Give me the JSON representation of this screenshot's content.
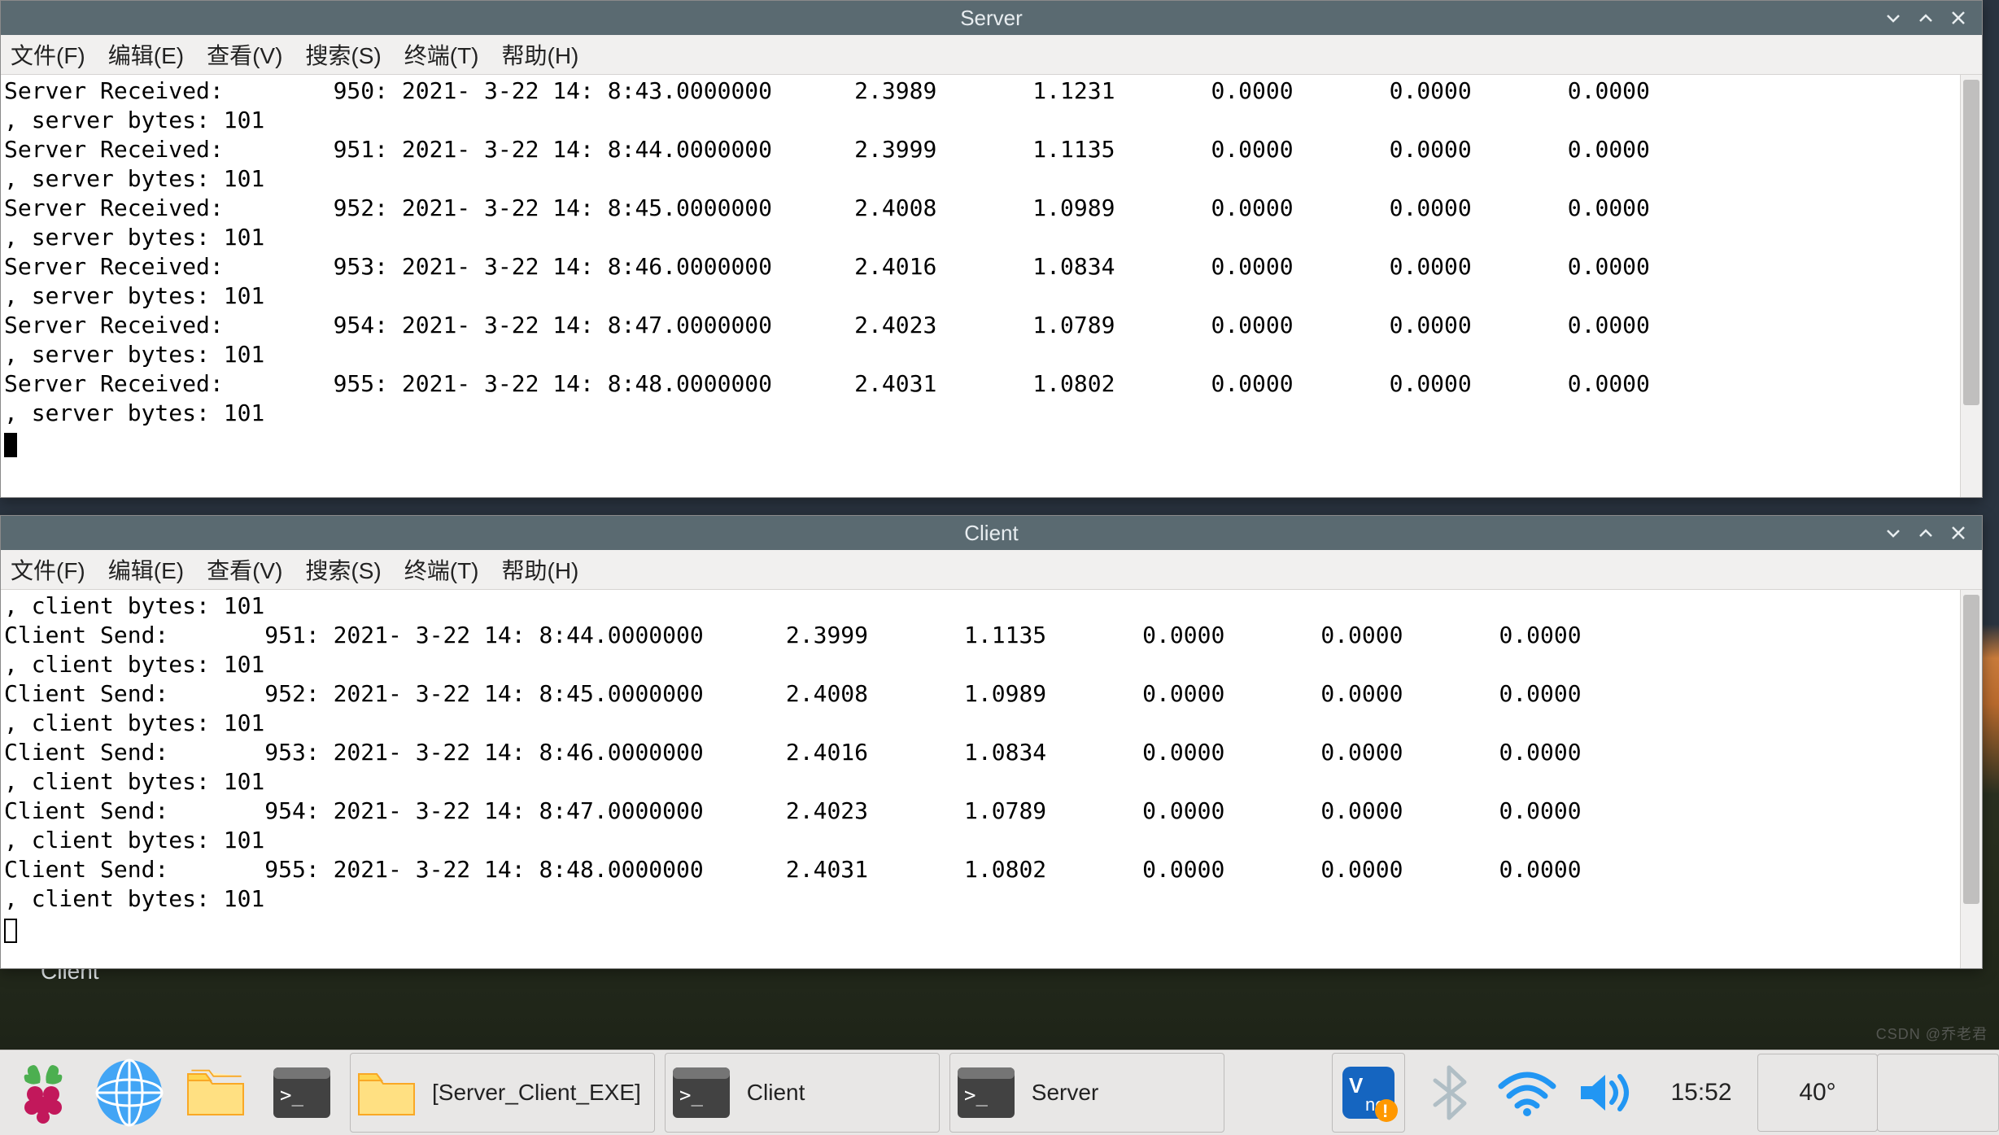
{
  "windows": {
    "server": {
      "title": "Server",
      "menu": {
        "file": "文件(F)",
        "edit": "编辑(E)",
        "view": "查看(V)",
        "search": "搜索(S)",
        "terminal": "终端(T)",
        "help": "帮助(H)"
      },
      "prefix_received": "Server Received:",
      "prefix_bytes": ", server bytes: 101",
      "rows": [
        {
          "n": "950",
          "ts": "2021- 3-22 14: 8:43.0000000",
          "v1": "2.3989",
          "v2": "1.1231",
          "v3": "0.0000",
          "v4": "0.0000",
          "v5": "0.0000"
        },
        {
          "n": "951",
          "ts": "2021- 3-22 14: 8:44.0000000",
          "v1": "2.3999",
          "v2": "1.1135",
          "v3": "0.0000",
          "v4": "0.0000",
          "v5": "0.0000"
        },
        {
          "n": "952",
          "ts": "2021- 3-22 14: 8:45.0000000",
          "v1": "2.4008",
          "v2": "1.0989",
          "v3": "0.0000",
          "v4": "0.0000",
          "v5": "0.0000"
        },
        {
          "n": "953",
          "ts": "2021- 3-22 14: 8:46.0000000",
          "v1": "2.4016",
          "v2": "1.0834",
          "v3": "0.0000",
          "v4": "0.0000",
          "v5": "0.0000"
        },
        {
          "n": "954",
          "ts": "2021- 3-22 14: 8:47.0000000",
          "v1": "2.4023",
          "v2": "1.0789",
          "v3": "0.0000",
          "v4": "0.0000",
          "v5": "0.0000"
        },
        {
          "n": "955",
          "ts": "2021- 3-22 14: 8:48.0000000",
          "v1": "2.4031",
          "v2": "1.0802",
          "v3": "0.0000",
          "v4": "0.0000",
          "v5": "0.0000"
        }
      ]
    },
    "client": {
      "title": "Client",
      "menu": {
        "file": "文件(F)",
        "edit": "编辑(E)",
        "view": "查看(V)",
        "search": "搜索(S)",
        "terminal": "终端(T)",
        "help": "帮助(H)"
      },
      "prefix_send": "Client Send:",
      "prefix_bytes": ", client bytes: 101",
      "rows": [
        {
          "n": "951",
          "ts": "2021- 3-22 14: 8:44.0000000",
          "v1": "2.3999",
          "v2": "1.1135",
          "v3": "0.0000",
          "v4": "0.0000",
          "v5": "0.0000"
        },
        {
          "n": "952",
          "ts": "2021- 3-22 14: 8:45.0000000",
          "v1": "2.4008",
          "v2": "1.0989",
          "v3": "0.0000",
          "v4": "0.0000",
          "v5": "0.0000"
        },
        {
          "n": "953",
          "ts": "2021- 3-22 14: 8:46.0000000",
          "v1": "2.4016",
          "v2": "1.0834",
          "v3": "0.0000",
          "v4": "0.0000",
          "v5": "0.0000"
        },
        {
          "n": "954",
          "ts": "2021- 3-22 14: 8:47.0000000",
          "v1": "2.4023",
          "v2": "1.0789",
          "v3": "0.0000",
          "v4": "0.0000",
          "v5": "0.0000"
        },
        {
          "n": "955",
          "ts": "2021- 3-22 14: 8:48.0000000",
          "v1": "2.4031",
          "v2": "1.0802",
          "v3": "0.0000",
          "v4": "0.0000",
          "v5": "0.0000"
        }
      ]
    }
  },
  "background_window_label": "Client",
  "taskbar": {
    "items": {
      "folder": "[Server_Client_EXE]",
      "client": "Client",
      "server": "Server"
    },
    "clock": "15:52",
    "temp": "40°"
  },
  "watermark": "CSDN @乔老君",
  "icons": {
    "raspberry": "raspberry-pi-icon",
    "globe": "web-browser-icon",
    "folder": "file-manager-icon",
    "terminal": "terminal-icon",
    "vnc": "vnc-server-icon",
    "bluetooth": "bluetooth-icon",
    "wifi": "wifi-icon",
    "sound": "sound-icon"
  }
}
